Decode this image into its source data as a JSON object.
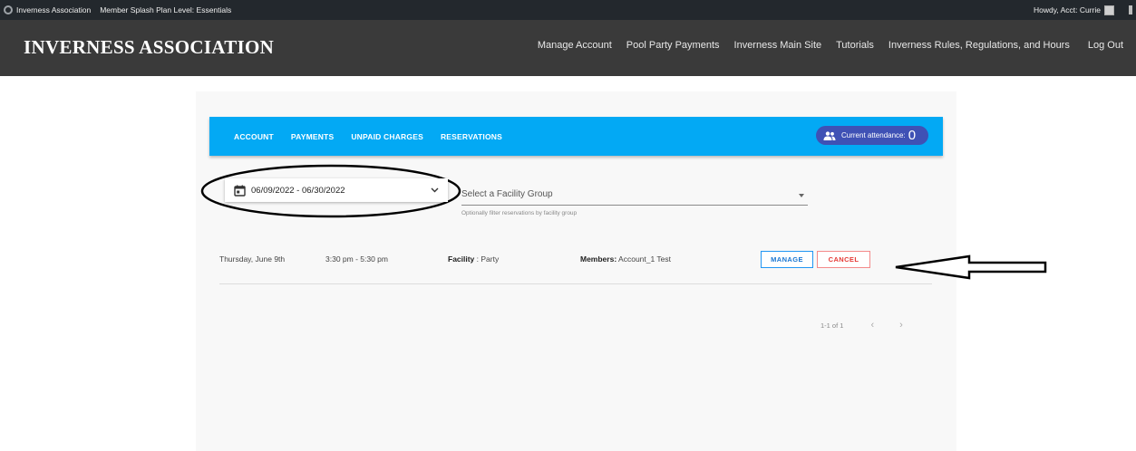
{
  "adminbar": {
    "site_name": "Inverness Association",
    "plan_level": "Member Splash Plan Level: Essentials",
    "howdy": "Howdy, Acct: Currie"
  },
  "header": {
    "site_title": "INVERNESS ASSOCIATION",
    "nav": [
      "Manage Account",
      "Pool Party Payments",
      "Inverness Main Site",
      "Tutorials",
      "Inverness Rules, Regulations, and Hours",
      "Log Out"
    ]
  },
  "toolbar": {
    "tabs": [
      "ACCOUNT",
      "PAYMENTS",
      "UNPAID CHARGES",
      "RESERVATIONS"
    ],
    "attendance_label": "Current attendance:",
    "attendance_count": "0"
  },
  "filters": {
    "date_range": "06/09/2022 - 06/30/2022",
    "facility_placeholder": "Select a Facility Group",
    "facility_hint": "Optionally filter reservations by facility group"
  },
  "reservations": [
    {
      "date": "Thursday, June 9th",
      "time": "3:30 pm - 5:30 pm",
      "facility_label": "Facility",
      "facility_value": " : Party",
      "members_label": "Members:",
      "members_value": " Account_1 Test",
      "manage_label": "MANAGE",
      "cancel_label": "CANCEL"
    }
  ],
  "pagination": {
    "range": "1-1 of 1",
    "prev": "‹",
    "next": "›"
  },
  "colors": {
    "toolbar": "#03a9f4",
    "attendance_badge": "#3f51b5",
    "manage": "#1976d2",
    "cancel": "#e53935"
  }
}
